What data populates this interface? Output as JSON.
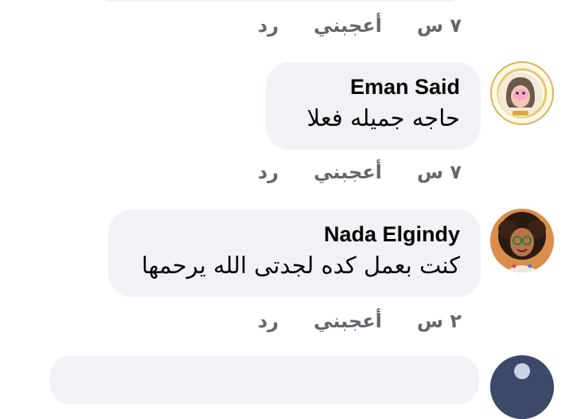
{
  "actions_labels": {
    "reply": "رد",
    "like": "أعجبني"
  },
  "previous_comment": {
    "time": "٧ س"
  },
  "comments": [
    {
      "author": "Eman Said",
      "text": "حاجه جميله فعلا",
      "time": "٧ س"
    },
    {
      "author": "Nada Elgindy",
      "text": "كنت بعمل كده لجدتى الله يرحمها",
      "time": "٢ س"
    }
  ]
}
